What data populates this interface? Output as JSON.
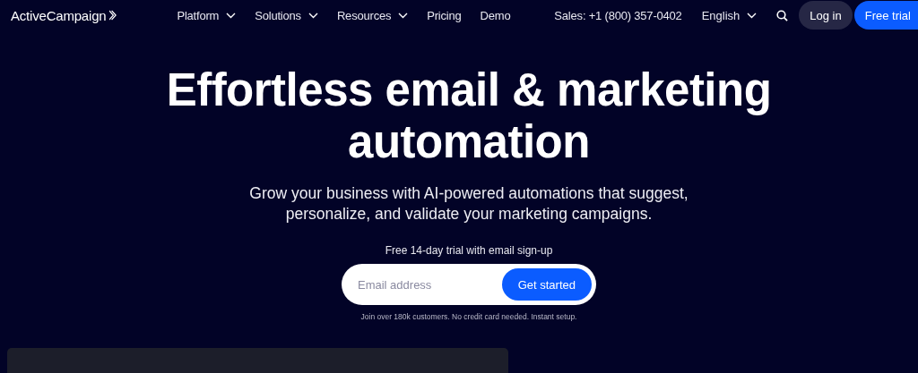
{
  "header": {
    "logo": "ActiveCampaign",
    "nav": [
      {
        "label": "Platform",
        "has_menu": true
      },
      {
        "label": "Solutions",
        "has_menu": true
      },
      {
        "label": "Resources",
        "has_menu": true
      },
      {
        "label": "Pricing",
        "has_menu": false
      },
      {
        "label": "Demo",
        "has_menu": false
      }
    ],
    "sales": "Sales: +1 (800) 357-0402",
    "language": "English",
    "login": "Log in",
    "free_trial": "Free trial"
  },
  "hero": {
    "headline_lines": [
      "Effortless email & marketing",
      "automation"
    ],
    "subtitle_lines": [
      "Grow your business with AI-powered automations that suggest,",
      "personalize, and validate your marketing campaigns."
    ],
    "trial_note": "Free 14-day trial with email sign-up",
    "email": {
      "placeholder": "Email address"
    },
    "submit": "Get started",
    "footnote": "Join over 180k customers. No credit card needed. Instant setup."
  }
}
